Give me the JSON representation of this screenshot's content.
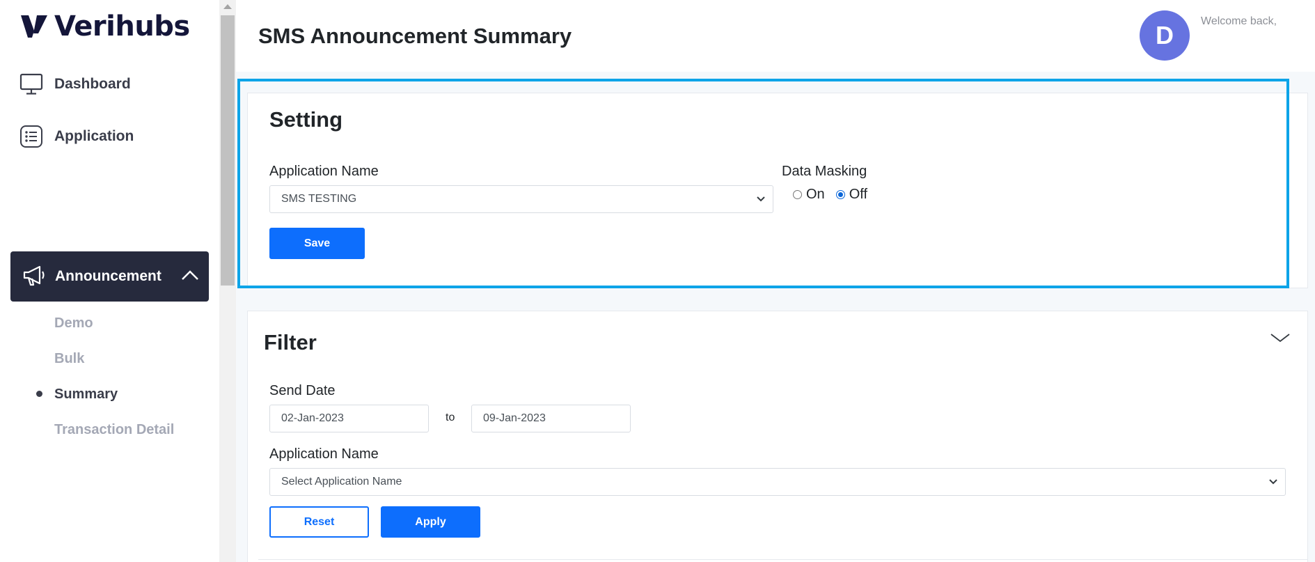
{
  "brand": {
    "name": "Verihubs",
    "color": "#14163a"
  },
  "sidebar": {
    "items": [
      {
        "label": "Dashboard",
        "icon": "monitor-icon"
      },
      {
        "label": "Application",
        "icon": "list-icon"
      }
    ],
    "active": {
      "label": "Announcement",
      "icon": "megaphone-icon",
      "expanded": true
    },
    "subitems": [
      {
        "label": "Demo"
      },
      {
        "label": "Bulk"
      },
      {
        "label": "Summary",
        "current": true
      },
      {
        "label": "Transaction Detail"
      }
    ]
  },
  "header": {
    "title": "SMS Announcement Summary",
    "avatar_initial": "D",
    "welcome": "Welcome back,"
  },
  "setting": {
    "title": "Setting",
    "app_name_label": "Application Name",
    "app_name_value": "SMS TESTING",
    "data_masking_label": "Data Masking",
    "radio_on": "On",
    "radio_off": "Off",
    "selected": "Off",
    "save_label": "Save"
  },
  "filter": {
    "title": "Filter",
    "send_date_label": "Send Date",
    "date_from": "02-Jan-2023",
    "to_text": "to",
    "date_to": "09-Jan-2023",
    "app_name_label": "Application Name",
    "app_name_placeholder": "Select Application Name",
    "reset_label": "Reset",
    "apply_label": "Apply"
  },
  "colors": {
    "primary": "#0d6efd",
    "highlight": "#0da4e8",
    "sidebar_active": "#262a3d",
    "avatar": "#6673e0"
  }
}
